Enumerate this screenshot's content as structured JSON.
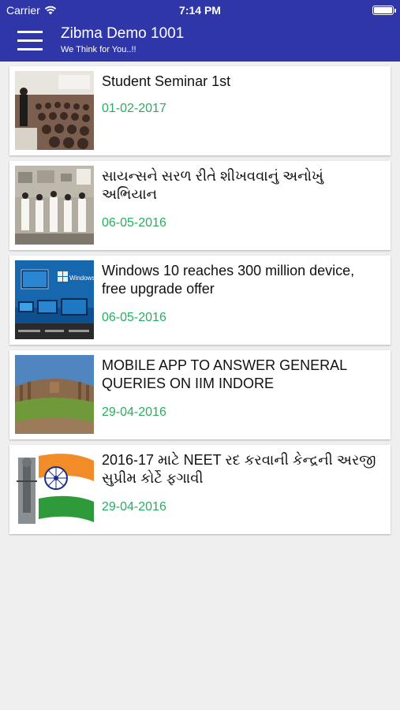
{
  "status_bar": {
    "carrier": "Carrier",
    "time": "7:14 PM",
    "wifi_icon": "wifi-icon",
    "battery_icon": "battery-icon"
  },
  "app_bar": {
    "menu_icon": "hamburger-menu-icon",
    "title": "Zibma Demo 1001",
    "subtitle": "We Think for You..!!",
    "color": "#2f36a8"
  },
  "date_color": "#27ae60",
  "news_items": [
    {
      "title": "Student Seminar 1st",
      "date": "01-02-2017",
      "thumbnail": "seminar-photo"
    },
    {
      "title": "સાયન્સને સરળ રીતે શીખવવાનું અનોખું અભિયાન",
      "date": "06-05-2016",
      "thumbnail": "science-class-photo"
    },
    {
      "title": "Windows 10 reaches 300 million device, free upgrade offer",
      "date": "06-05-2016",
      "thumbnail": "windows-10-devices-photo",
      "thumbnail_text": "Windows 10"
    },
    {
      "title": "MOBILE APP TO ANSWER GENERAL QUERIES ON IIM INDORE",
      "date": "29-04-2016",
      "thumbnail": "iim-campus-photo"
    },
    {
      "title": "2016-17 માટે NEET રદ કરવાની કેન્દ્રની અરજી સુપ્રીમ કોર્ટે ફગાવી",
      "date": "29-04-2016",
      "thumbnail": "india-flag-justice-photo"
    }
  ]
}
